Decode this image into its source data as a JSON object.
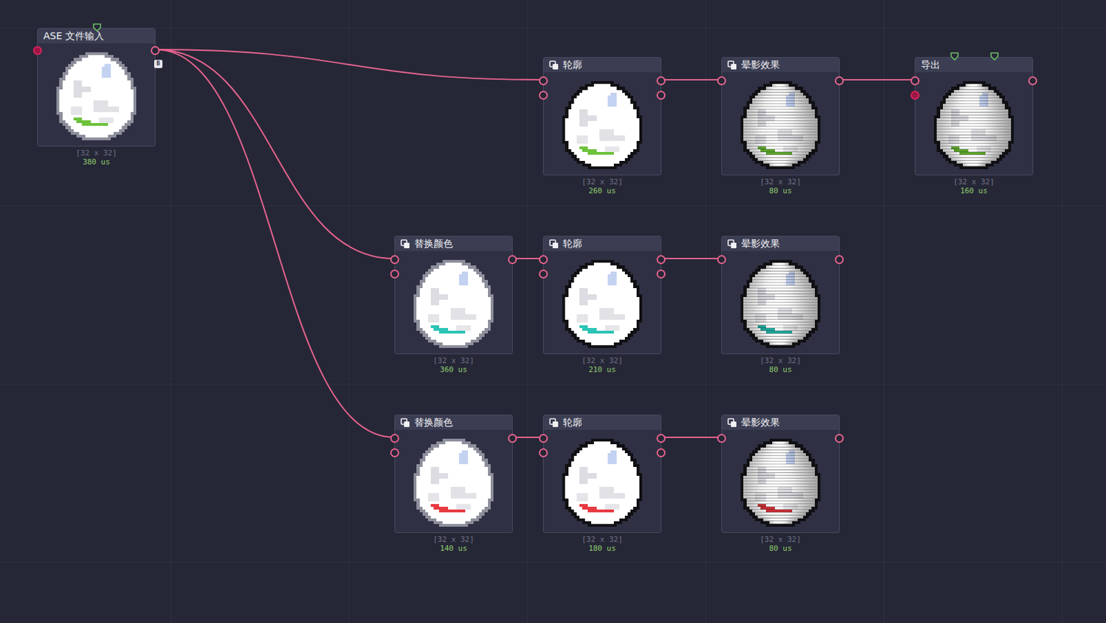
{
  "nodes": [
    {
      "title": "ASE 文件输入",
      "size": "[32 x 32]",
      "time": "380 us",
      "kind": "plain",
      "color": "#6cc23a",
      "copy": false,
      "badge": "B",
      "markers": 1,
      "inputs": [
        {
          "filled": true
        }
      ],
      "outputs": 1
    },
    {
      "title": "轮廓",
      "size": "[32 x 32]",
      "time": "260 us",
      "kind": "outline",
      "color": "#6cc23a",
      "copy": true,
      "badge": "",
      "markers": 0,
      "inputs": [
        {
          "filled": false
        },
        {
          "filled": false
        }
      ],
      "outputs": 2
    },
    {
      "title": "晕影效果",
      "size": "[32 x 32]",
      "time": "80 us",
      "kind": "vignette",
      "color": "#5fa62e",
      "copy": true,
      "badge": "",
      "markers": 0,
      "inputs": [
        {
          "filled": false
        }
      ],
      "outputs": 1
    },
    {
      "title": "导出",
      "size": "[32 x 32]",
      "time": "160 us",
      "kind": "vignette",
      "color": "#5fa62e",
      "copy": false,
      "badge": "",
      "markers": 2,
      "inputs": [
        {
          "filled": false
        },
        {
          "filled": true
        }
      ],
      "outputs": 1
    },
    {
      "title": "替换颜色",
      "size": "[32 x 32]",
      "time": "360 us",
      "kind": "plain",
      "color": "#2bc4b6",
      "copy": true,
      "badge": "",
      "markers": 0,
      "inputs": [
        {
          "filled": false
        },
        {
          "filled": false
        }
      ],
      "outputs": 1
    },
    {
      "title": "轮廓",
      "size": "[32 x 32]",
      "time": "210 us",
      "kind": "outline",
      "color": "#2bc4b6",
      "copy": true,
      "badge": "",
      "markers": 0,
      "inputs": [
        {
          "filled": false
        },
        {
          "filled": false
        }
      ],
      "outputs": 2
    },
    {
      "title": "晕影效果",
      "size": "[32 x 32]",
      "time": "80 us",
      "kind": "vignette",
      "color": "#22a89c",
      "copy": true,
      "badge": "",
      "markers": 0,
      "inputs": [
        {
          "filled": false
        }
      ],
      "outputs": 1
    },
    {
      "title": "替换颜色",
      "size": "[32 x 32]",
      "time": "140 us",
      "kind": "plain",
      "color": "#e8383f",
      "copy": true,
      "badge": "",
      "markers": 0,
      "inputs": [
        {
          "filled": false
        },
        {
          "filled": false
        }
      ],
      "outputs": 1
    },
    {
      "title": "轮廓",
      "size": "[32 x 32]",
      "time": "180 us",
      "kind": "outline",
      "color": "#e8383f",
      "copy": true,
      "badge": "",
      "markers": 0,
      "inputs": [
        {
          "filled": false
        },
        {
          "filled": false
        }
      ],
      "outputs": 2
    },
    {
      "title": "晕影效果",
      "size": "[32 x 32]",
      "time": "80 us",
      "kind": "vignette",
      "color": "#c93036",
      "copy": true,
      "badge": "",
      "markers": 0,
      "inputs": [
        {
          "filled": false
        }
      ],
      "outputs": 1
    }
  ],
  "links": [
    [
      0,
      1
    ],
    [
      1,
      2
    ],
    [
      2,
      3
    ],
    [
      0,
      4
    ],
    [
      4,
      5
    ],
    [
      5,
      6
    ],
    [
      0,
      7
    ],
    [
      7,
      8
    ],
    [
      8,
      9
    ]
  ]
}
